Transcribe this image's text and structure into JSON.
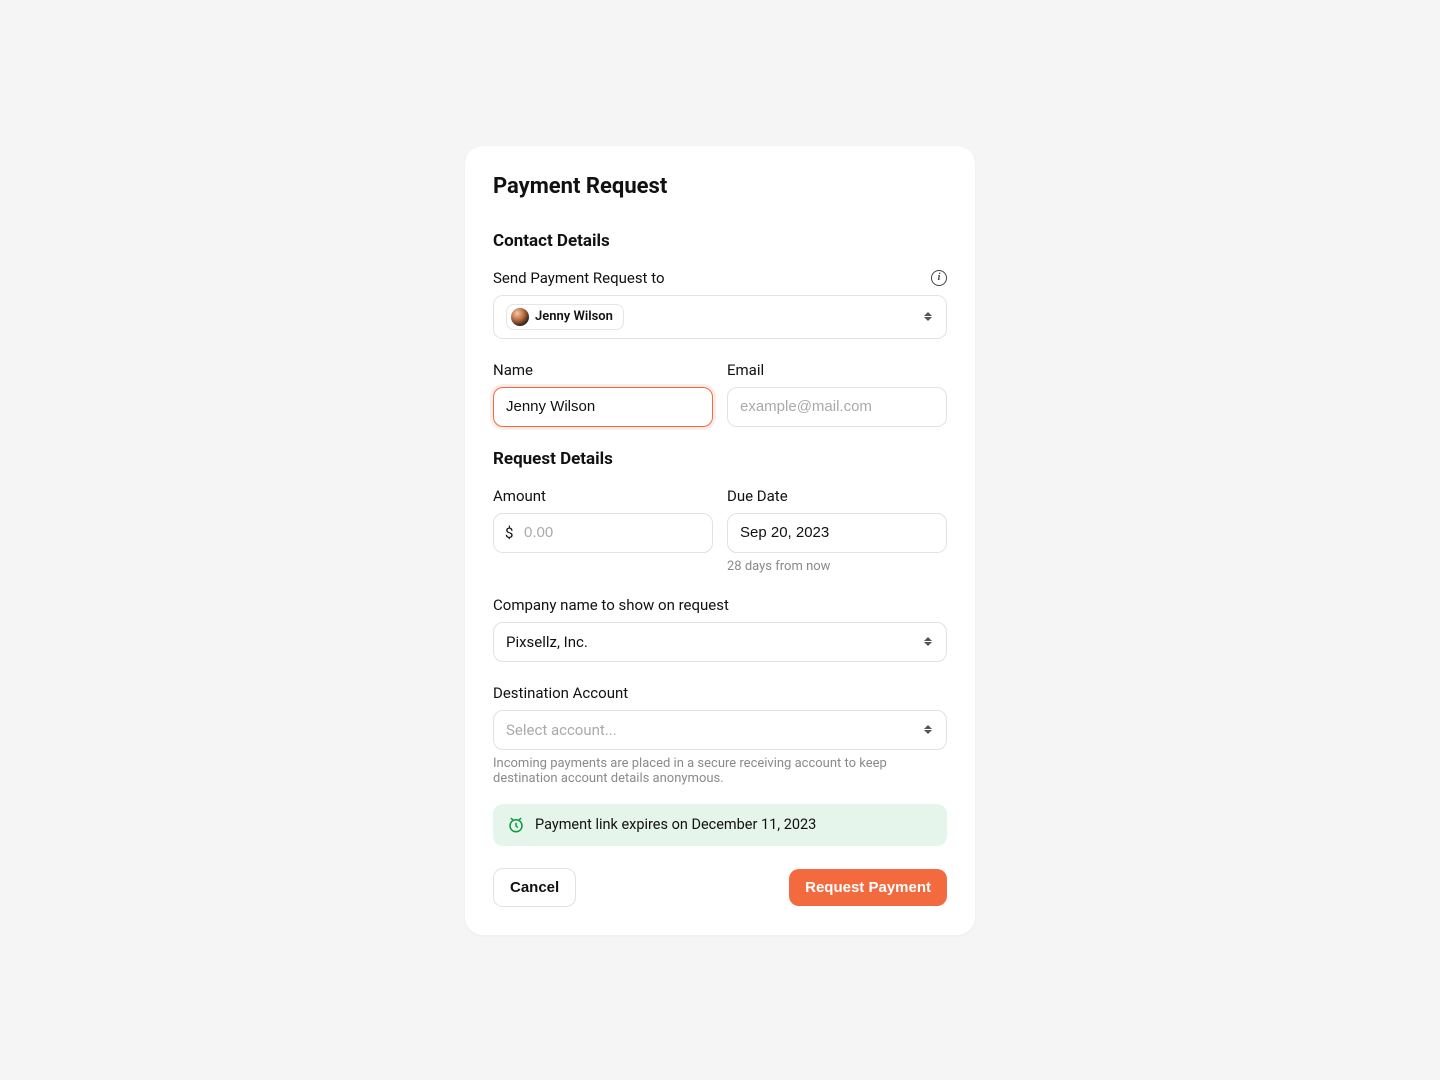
{
  "title": "Payment Request",
  "contact": {
    "section_title": "Contact Details",
    "send_to_label": "Send Payment Request to",
    "selected_contact": "Jenny Wilson",
    "name_label": "Name",
    "name_value": "Jenny Wilson",
    "email_label": "Email",
    "email_placeholder": "example@mail.com"
  },
  "request": {
    "section_title": "Request Details",
    "amount_label": "Amount",
    "amount_prefix": "$",
    "amount_placeholder": "0.00",
    "due_label": "Due Date",
    "due_value": "Sep 20, 2023",
    "due_helper": "28 days from now",
    "company_label": "Company name to show on request",
    "company_value": "Pixsellz, Inc.",
    "destination_label": "Destination Account",
    "destination_placeholder": "Select account...",
    "destination_helper": "Incoming payments are placed in a secure receiving account to keep destination account details anonymous."
  },
  "notice": {
    "text": "Payment link expires on December 11, 2023"
  },
  "footer": {
    "cancel": "Cancel",
    "submit": "Request Payment"
  }
}
